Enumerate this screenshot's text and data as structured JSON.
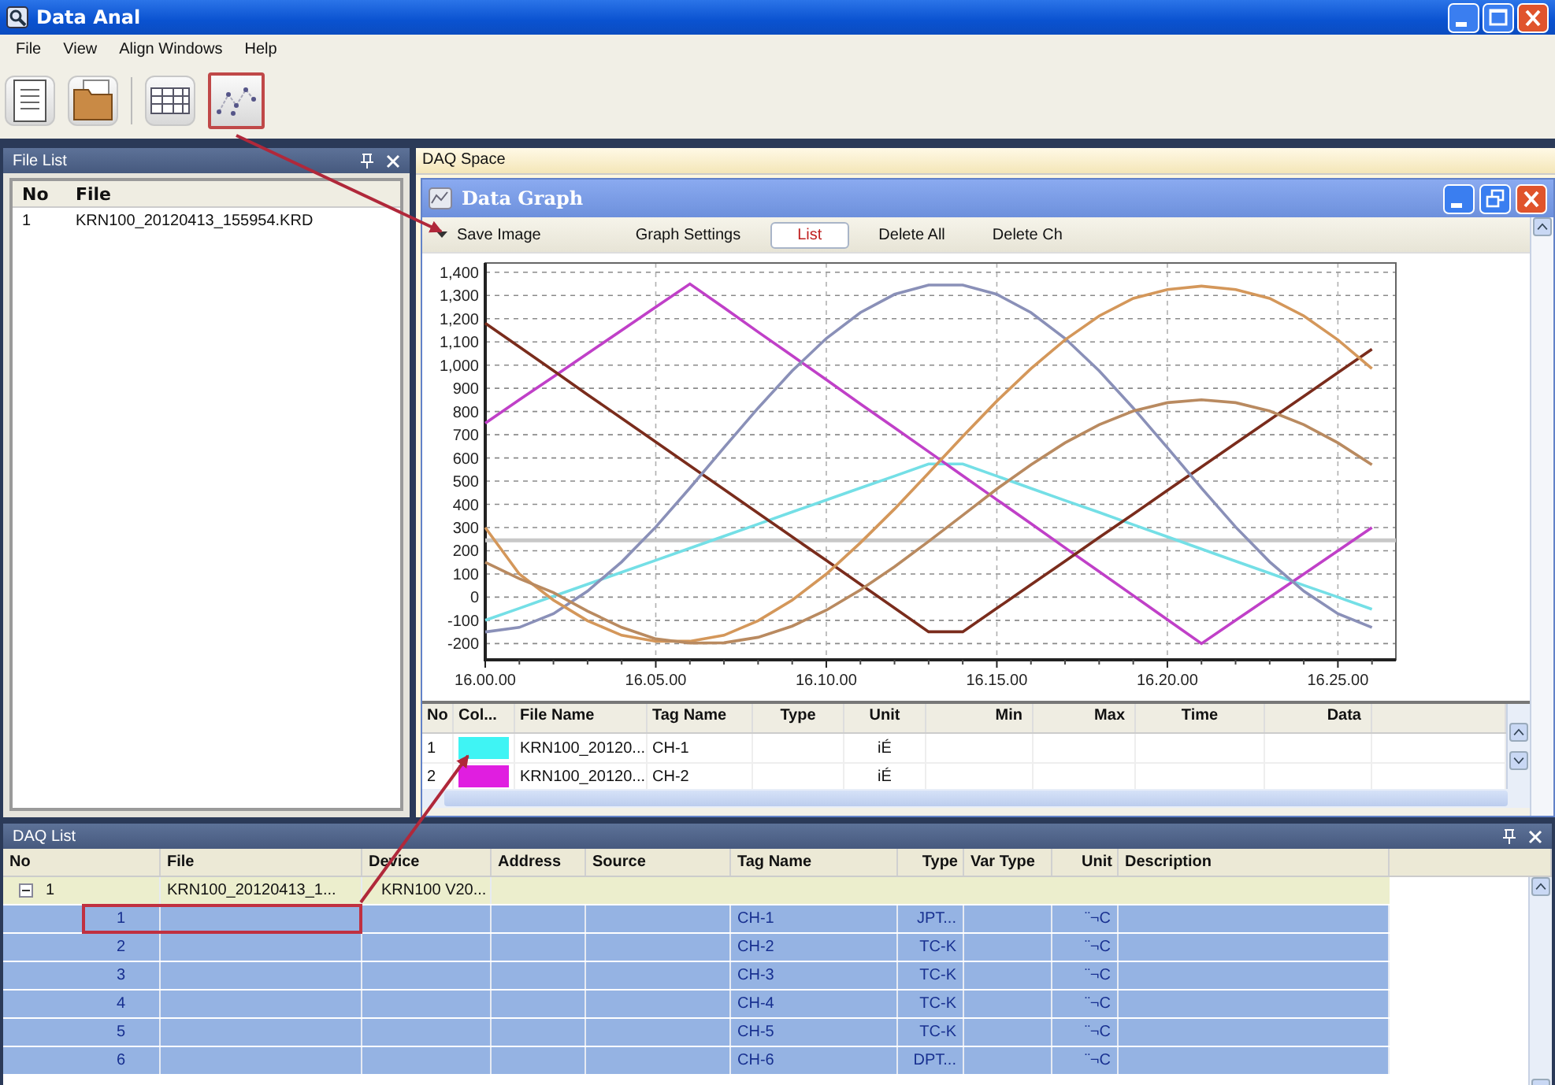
{
  "window": {
    "title": "Data Anal"
  },
  "menu": [
    "File",
    "View",
    "Align Windows",
    "Help"
  ],
  "toolbar": [
    {
      "kind": "document",
      "highlighted": false
    },
    {
      "kind": "folder",
      "highlighted": false
    },
    {
      "kind": "table",
      "highlighted": false
    },
    {
      "kind": "graph",
      "highlighted": true
    }
  ],
  "file_list": {
    "title": "File List",
    "columns": [
      "No",
      "File"
    ],
    "rows": [
      [
        "1",
        "KRN100_20120413_155954.KRD"
      ]
    ]
  },
  "daq_space": {
    "tab": "DAQ Space",
    "graph_window": {
      "title": "Data Graph",
      "toolbar": [
        {
          "kind": "menu",
          "label": "Save Image",
          "selected": false
        },
        {
          "kind": "button",
          "label": "Graph Settings",
          "selected": false
        },
        {
          "kind": "button",
          "label": "List",
          "selected": true
        },
        {
          "kind": "button",
          "label": "Delete All",
          "selected": false
        },
        {
          "kind": "button",
          "label": "Delete Ch",
          "selected": false
        }
      ],
      "chart_data": {
        "type": "line",
        "categories": [
          "16.00.00",
          null,
          null,
          null,
          null,
          "16.05.00",
          null,
          null,
          null,
          null,
          "16.10.00",
          null,
          null,
          null,
          null,
          "16.15.00",
          null,
          null,
          null,
          null,
          "16.20.00",
          null,
          null,
          null,
          null,
          "16.25.00",
          null
        ],
        "grid": true,
        "ylim": [
          -270,
          1440
        ],
        "yticks": [
          {
            "value": 1400,
            "label": "1,400"
          },
          {
            "value": 1300,
            "label": "1,300"
          },
          {
            "value": 1200,
            "label": "1,200"
          },
          {
            "value": 1100,
            "label": "1,100"
          },
          {
            "value": 1000,
            "label": "1,000"
          },
          900,
          800,
          700,
          600,
          500,
          400,
          300,
          200,
          100,
          0,
          -100,
          -200
        ],
        "series": [
          {
            "color": "#74dfe6",
            "values": [
              -100,
              -48,
              4,
              56,
              107,
              159,
              211,
              263,
              315,
              367,
              419,
              470,
              522,
              574,
              574,
              522,
              469,
              417,
              365,
              312,
              260,
              208,
              155,
              103,
              51,
              0,
              -52
            ]
          },
          {
            "color": "#c040c8",
            "values": [
              750,
              850,
              950,
              1050,
              1150,
              1250,
              1350,
              1247,
              1143,
              1040,
              937,
              833,
              730,
              627,
              523,
              420,
              317,
              213,
              110,
              7,
              -97,
              -200,
              -100,
              0,
              100,
              200,
              300
            ]
          },
          {
            "color": "#7a2c1c",
            "values": [
              1180,
              1078,
              976,
              873,
              771,
              669,
              567,
              465,
              362,
              260,
              158,
              56,
              -47,
              -149,
              -149,
              -48,
              54,
              155,
              257,
              358,
              460,
              561,
              663,
              764,
              866,
              968,
              1069
            ]
          },
          {
            "color": "#8a90b8",
            "values": [
              -150,
              -130,
              -71,
              26,
              152,
              302,
              470,
              644,
              815,
              975,
              1115,
              1226,
              1305,
              1345,
              1345,
              1305,
              1226,
              1115,
              975,
              815,
              644,
              470,
              302,
              152,
              26,
              -71,
              -130
            ]
          },
          {
            "color": "#d4975a",
            "values": [
              300,
              100,
              -13,
              -102,
              -164,
              -190,
              -190,
              -164,
              -102,
              -13,
              100,
              234,
              380,
              535,
              693,
              845,
              985,
              1109,
              1212,
              1287,
              1325,
              1340,
              1325,
              1287,
              1212,
              1109,
              985
            ]
          },
          {
            "color": "#b98a60",
            "values": [
              150,
              80,
              20,
              -60,
              -130,
              -180,
              -198,
              -197,
              -173,
              -125,
              -56,
              31,
              131,
              240,
              353,
              466,
              571,
              665,
              743,
              802,
              838,
              850,
              838,
              802,
              743,
              665,
              571
            ]
          }
        ],
        "ref_lines": [
          {
            "axis": "y",
            "value": 245
          }
        ]
      },
      "list": {
        "columns": [
          "No",
          "Col...",
          "File Name",
          "Tag Name",
          "Type",
          "Unit",
          "Min",
          "Max",
          "Time",
          "Data"
        ],
        "rows": [
          {
            "no": "1",
            "color": "#3ff4f4",
            "file_name": "KRN100_20120...",
            "tag_name": "CH-1",
            "unit": "iÉ"
          },
          {
            "no": "2",
            "color": "#e01ee0",
            "file_name": "KRN100_20120...",
            "tag_name": "CH-2",
            "unit": "iÉ"
          }
        ]
      }
    }
  },
  "daq_list": {
    "title": "DAQ List",
    "columns": [
      "No",
      "File",
      "Device",
      "Address",
      "Source",
      "Tag Name",
      "Type",
      "Var Type",
      "Unit",
      "Description"
    ],
    "groups": [
      {
        "no": "1",
        "file": "KRN100_20120413_1...",
        "device": "KRN100 V20...",
        "expanded": true,
        "children": [
          {
            "no": "1",
            "tag_name": "CH-1",
            "type": "JPT...",
            "unit": "¨¬C",
            "selected": true,
            "highlighted": true
          },
          {
            "no": "2",
            "tag_name": "CH-2",
            "type": "TC-K",
            "unit": "¨¬C",
            "selected": true
          },
          {
            "no": "3",
            "tag_name": "CH-3",
            "type": "TC-K",
            "unit": "¨¬C",
            "selected": true
          },
          {
            "no": "4",
            "tag_name": "CH-4",
            "type": "TC-K",
            "unit": "¨¬C",
            "selected": true
          },
          {
            "no": "5",
            "tag_name": "CH-5",
            "type": "TC-K",
            "unit": "¨¬C",
            "selected": true
          },
          {
            "no": "6",
            "tag_name": "CH-6",
            "type": "DPT...",
            "unit": "¨¬C",
            "selected": true
          }
        ]
      }
    ]
  }
}
